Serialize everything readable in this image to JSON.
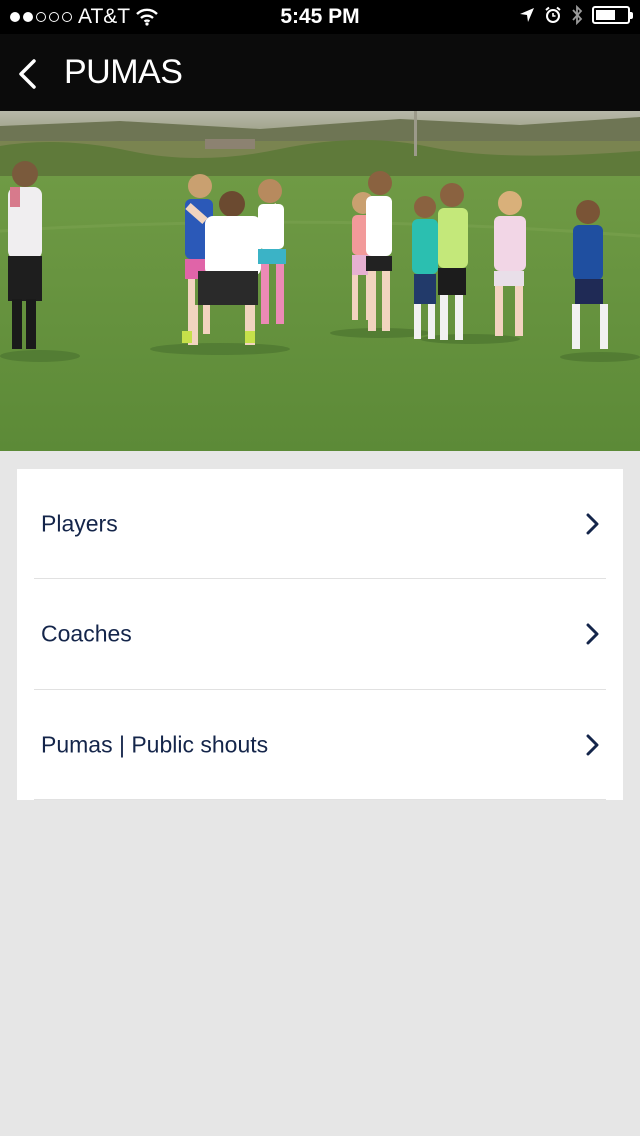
{
  "status_bar": {
    "carrier": "AT&T",
    "time": "5:45 PM",
    "signal_bars_filled": 2,
    "signal_bars_total": 5,
    "battery_level": 0.55
  },
  "nav": {
    "title": "PUMAS",
    "back_icon": "chevron-left-icon"
  },
  "hero": {
    "description_icon": "team-photo"
  },
  "menu": {
    "items": [
      {
        "label": "Players",
        "icon": "chevron-right-icon"
      },
      {
        "label": "Coaches",
        "icon": "chevron-right-icon"
      },
      {
        "label": "Pumas | Public shouts",
        "icon": "chevron-right-icon"
      }
    ]
  },
  "colors": {
    "nav_background": "#0b0b0b",
    "page_background": "#e6e6e6",
    "menu_text": "#14254a",
    "chevron": "#14254a"
  }
}
